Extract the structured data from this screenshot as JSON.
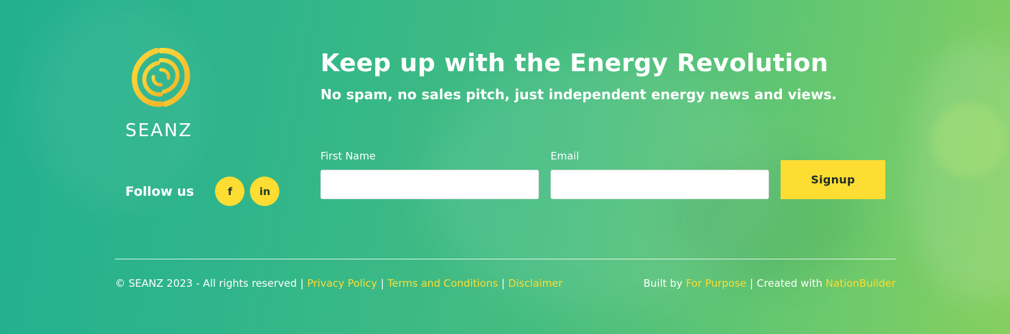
{
  "brand": {
    "name": "SEANZ",
    "logo_icon": "swirl-sun-icon",
    "colors": {
      "accent_yellow": "#fedd32",
      "background_green": "#2fb58b",
      "text_white": "#ffffff"
    }
  },
  "social": {
    "label": "Follow us",
    "items": [
      {
        "icon": "facebook-icon",
        "glyph": "f"
      },
      {
        "icon": "linkedin-icon",
        "glyph": "in"
      }
    ]
  },
  "newsletter": {
    "headline": "Keep up with the Energy Revolution",
    "subline": "No spam, no sales pitch, just independent energy news and views.",
    "first_name": {
      "label": "First Name",
      "value": "",
      "placeholder": ""
    },
    "email": {
      "label": "Email",
      "value": "",
      "placeholder": ""
    },
    "submit_label": "Signup"
  },
  "footer": {
    "copyright": "© SEANZ 2023 - All rights reserved",
    "separator": "|",
    "links": {
      "privacy": "Privacy Policy",
      "terms": "Terms and Conditions",
      "disclaimer": "Disclaimer"
    },
    "built_by_prefix": "Built by",
    "built_by_link": "For Purpose",
    "created_with_prefix": "Created with",
    "created_with_link": "NationBuilder"
  }
}
